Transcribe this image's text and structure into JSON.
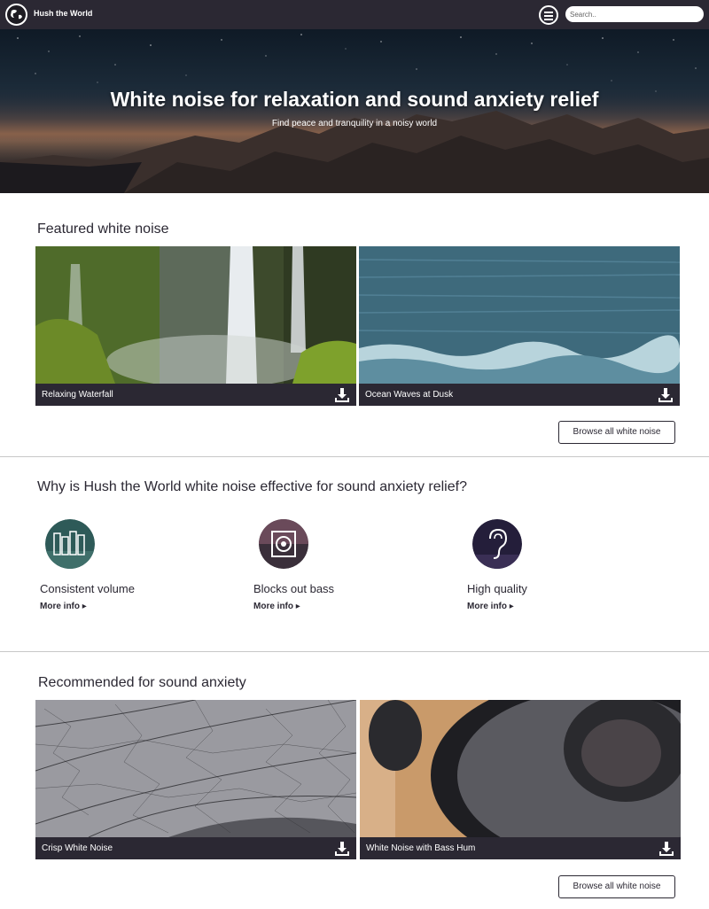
{
  "nav": {
    "brand": "Hush the World",
    "search_placeholder": "Search.."
  },
  "hero": {
    "title": "White noise for relaxation and sound anxiety relief",
    "subtitle": "Find peace and tranquility in a noisy world"
  },
  "featured": {
    "heading": "Featured white noise",
    "cards": [
      {
        "label": "Relaxing Waterfall"
      },
      {
        "label": "Ocean Waves at Dusk"
      }
    ],
    "browse_label": "Browse all white noise"
  },
  "why": {
    "heading": "Why is Hush the World white noise effective for sound anxiety relief?",
    "features": [
      {
        "title": "Consistent volume",
        "more": "More info ▸"
      },
      {
        "title": "Blocks out bass",
        "more": "More info ▸"
      },
      {
        "title": "High quality",
        "more": "More info ▸"
      }
    ]
  },
  "recommended": {
    "heading": "Recommended for sound anxiety",
    "cards": [
      {
        "label": "Crisp White Noise"
      },
      {
        "label": "White Noise with Bass Hum"
      }
    ],
    "browse_label": "Browse all white noise"
  },
  "colors": {
    "nav_bg": "#2b2833",
    "text": "#2b2833",
    "white": "#ffffff"
  }
}
